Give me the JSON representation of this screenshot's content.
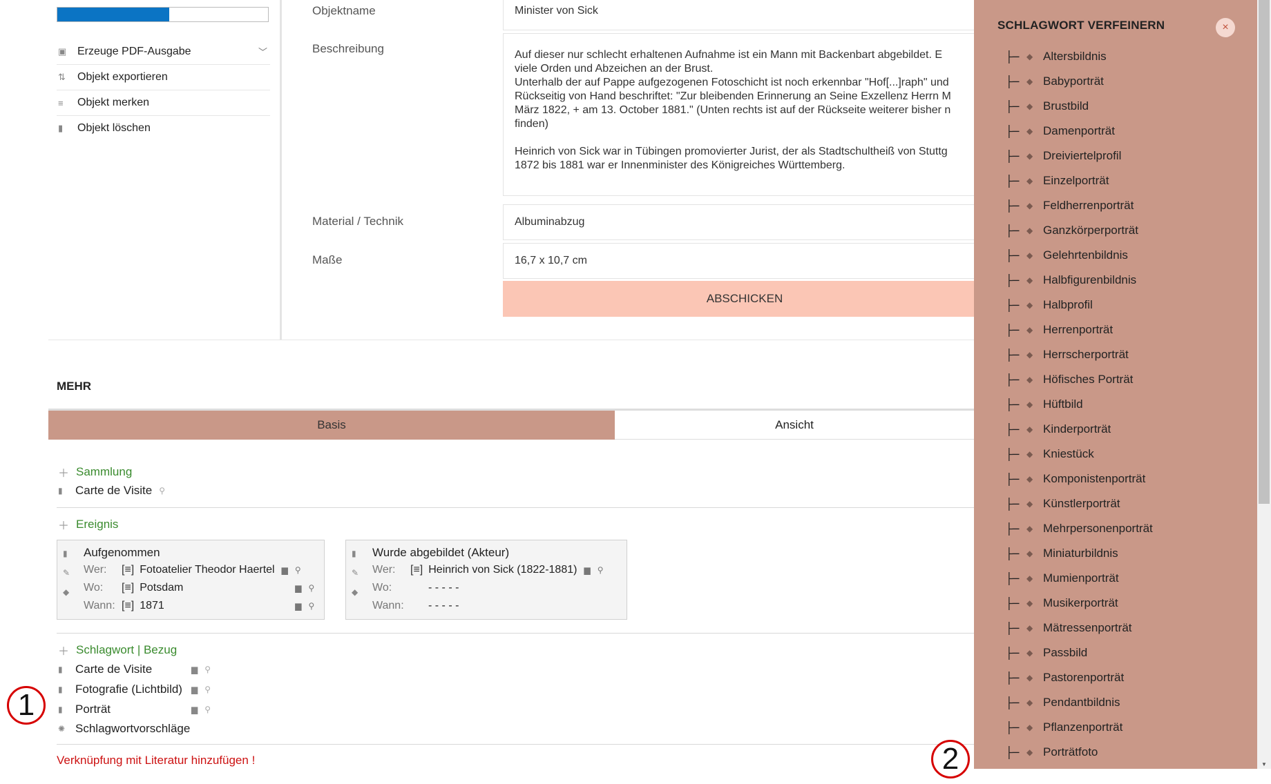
{
  "progress": 0.53,
  "actions": [
    {
      "label": "Erzeuge PDF-Ausgabe",
      "icon": "pdf-icon"
    },
    {
      "label": "Objekt exportieren",
      "icon": "export-icon"
    },
    {
      "label": "Objekt merken",
      "icon": "bookmark-list-icon"
    },
    {
      "label": "Objekt löschen",
      "icon": "trash-icon"
    }
  ],
  "form": {
    "objektname_label": "Objektname",
    "objektname_value": "Minister von Sick",
    "beschreibung_label": "Beschreibung",
    "beschreibung_lines": [
      "Auf dieser nur schlecht erhaltenen Aufnahme ist ein Mann mit Backenbart abgebildet. E",
      "viele Orden und Abzeichen an der Brust.",
      "Unterhalb der auf Pappe aufgezogenen Fotoschicht ist noch erkennbar \"Hof[...]raph\" und",
      "Rückseitig von Hand beschriftet: \"Zur bleibenden Erinnerung an Seine Exzellenz Herrn M",
      "März 1822, + am 13. October 1881.\" (Unten rechts ist auf der Rückseite weiterer bisher n",
      "finden)",
      "",
      "Heinrich von Sick war in Tübingen promovierter Jurist, der als Stadtschultheiß von Stuttg",
      "1872 bis 1881 war er Innenminister des Königreiches Württemberg."
    ],
    "material_label": "Material / Technik",
    "material_value": "Albuminabzug",
    "masse_label": "Maße",
    "masse_value": "16,7 x 10,7 cm",
    "submit_label": "ABSCHICKEN"
  },
  "mehr": {
    "title": "MEHR",
    "tabs": [
      "Basis",
      "Ansicht"
    ]
  },
  "sammlung": {
    "heading": "Sammlung",
    "items": [
      "Carte de Visite"
    ]
  },
  "ereignis": {
    "heading": "Ereignis",
    "cards": [
      {
        "title": "Aufgenommen",
        "rows": [
          {
            "key": "Wer:",
            "bracket": "[≡]",
            "value": "Fotoatelier Theodor Haertel"
          },
          {
            "key": "Wo:",
            "bracket": "[≡]",
            "value": "Potsdam"
          },
          {
            "key": "Wann:",
            "bracket": "[≡]",
            "value": "1871"
          }
        ]
      },
      {
        "title": "Wurde abgebildet (Akteur)",
        "rows": [
          {
            "key": "Wer:",
            "bracket": "[≡]",
            "value": "Heinrich von Sick (1822-1881)"
          },
          {
            "key": "Wo:",
            "bracket": "",
            "value": "- - - - -"
          },
          {
            "key": "Wann:",
            "bracket": "",
            "value": "- - - - -"
          }
        ]
      }
    ]
  },
  "schlagwort": {
    "heading": "Schlagwort | Bezug",
    "items": [
      "Carte de Visite",
      "Fotografie (Lichtbild)",
      "Porträt"
    ],
    "suggestions": "Schlagwortvorschläge"
  },
  "literatur_link": "Verknüpfung mit Literatur hinzufügen !",
  "annotations": [
    "1",
    "2"
  ],
  "panel": {
    "title": "SCHLAGWORT VERFEINERN",
    "close": "×",
    "tree_glyph": "├─",
    "items": [
      "Altersbildnis",
      "Babyporträt",
      "Brustbild",
      "Damenporträt",
      "Dreiviertelprofil",
      "Einzelporträt",
      "Feldherrenporträt",
      "Ganzkörperporträt",
      "Gelehrtenbildnis",
      "Halbfigurenbildnis",
      "Halbprofil",
      "Herrenporträt",
      "Herrscherporträt",
      "Höfisches Porträt",
      "Hüftbild",
      "Kinderporträt",
      "Kniestück",
      "Komponistenporträt",
      "Künstlerporträt",
      "Mehrpersonenporträt",
      "Miniaturbildnis",
      "Mumienporträt",
      "Musikerporträt",
      "Mätressenporträt",
      "Passbild",
      "Pastorenporträt",
      "Pendantbildnis",
      "Pflanzenporträt",
      "Porträtfoto"
    ]
  },
  "colors": {
    "panel": "#c99888",
    "active_tab": "#c99888",
    "submit": "#fbc6b5",
    "section_green": "#3a8b2e",
    "link_red": "#cc1111",
    "progress": "#0b74c4"
  }
}
